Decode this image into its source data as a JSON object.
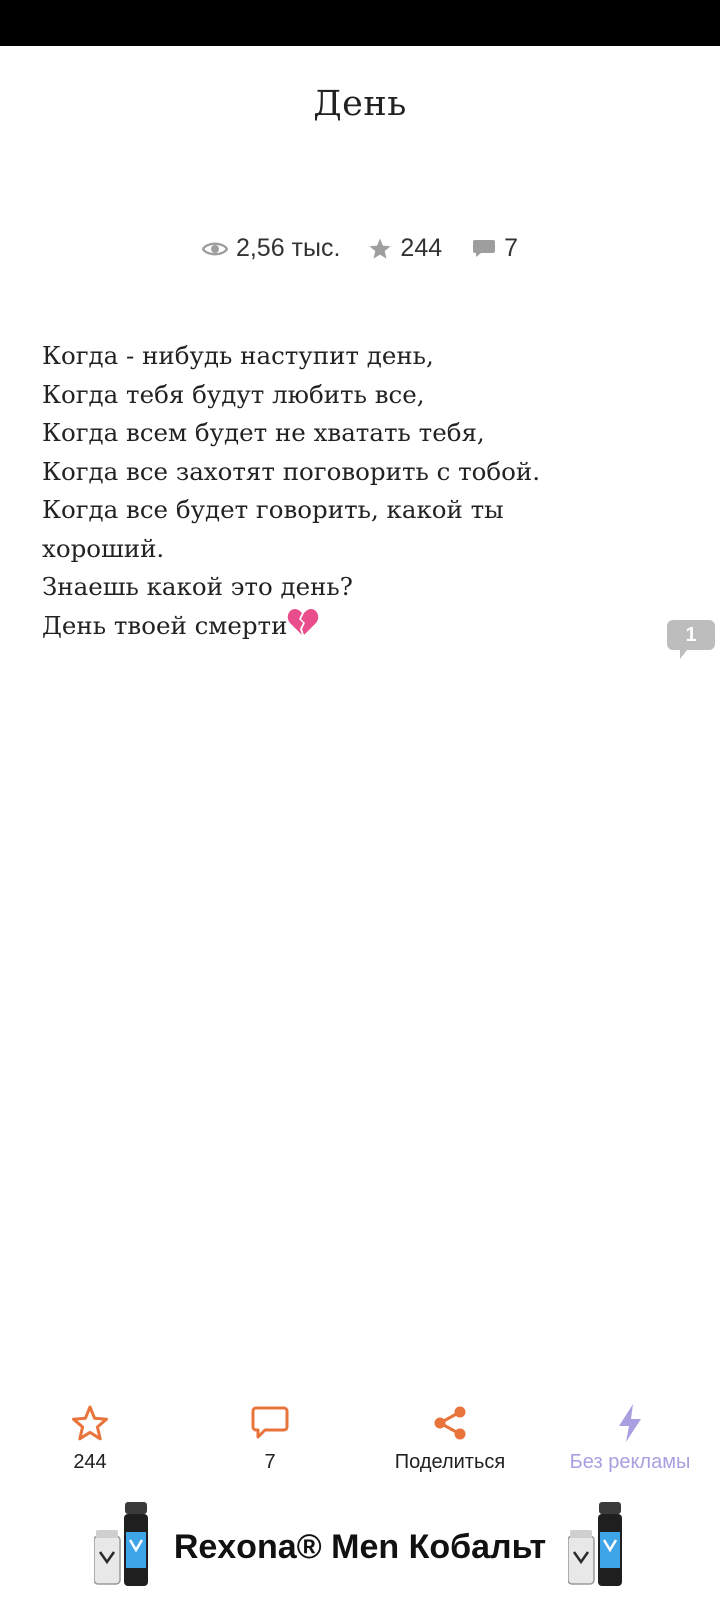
{
  "title": "День",
  "stats": {
    "views": "2,56 тыс.",
    "stars": "244",
    "comments": "7"
  },
  "poem": {
    "lines": [
      "Когда - нибудь наступит день,",
      "Когда тебя будут любить все,",
      "Когда всем будет не хватать тебя,",
      "Когда все захотят поговорить с тобой.",
      "Когда все будет говорить, какой ты",
      "хороший.",
      "Знаешь какой это день?",
      "День твоей смерти"
    ],
    "emoji_icon": "broken-heart-icon"
  },
  "side_comment_count": "1",
  "bottom_bar": {
    "star_count": "244",
    "comment_count": "7",
    "share_label": "Поделиться",
    "no_ads_label": "Без рекламы"
  },
  "ad": {
    "text": "Rexona® Men Кобальт"
  },
  "colors": {
    "accent": "#e8743b",
    "muted_accent": "#a99fe0",
    "stat_icon": "#9e9e9e"
  }
}
